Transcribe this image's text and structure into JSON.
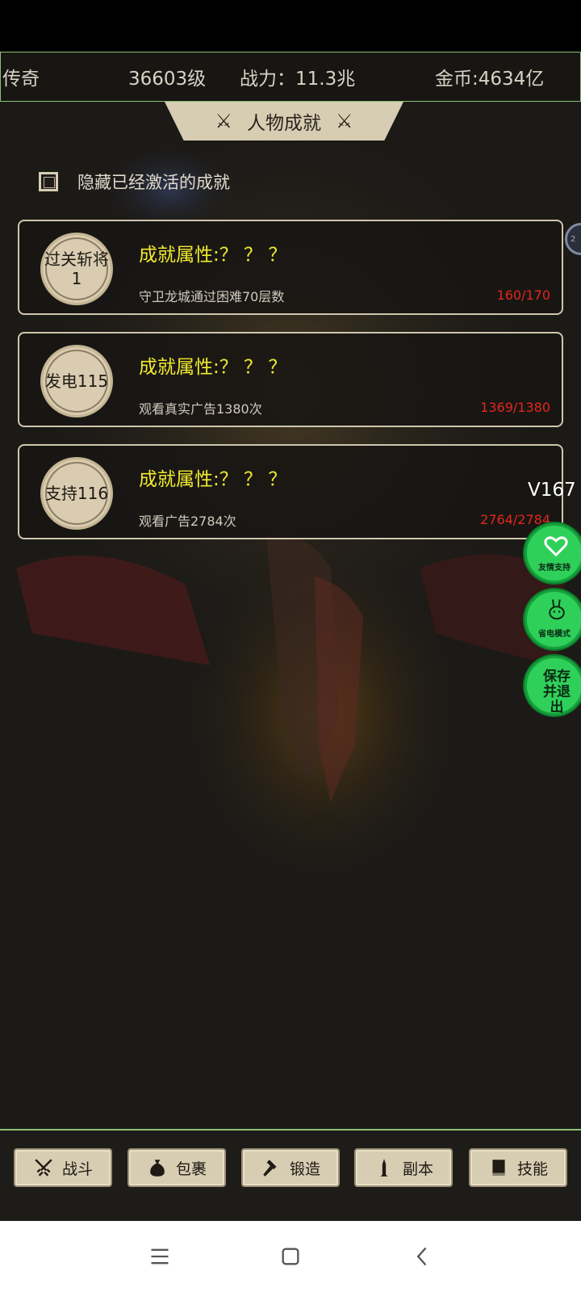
{
  "topbar": {
    "rank": "传奇",
    "level": "36603级",
    "power": "战力：11.3兆",
    "gold": "金币:4634亿"
  },
  "title": "人物成就",
  "hide_toggle": {
    "label": "隐藏已经激活的成就",
    "checked": false
  },
  "achievements": [
    {
      "badge": "过关斩将1",
      "attr": "成就属性:？ ？ ？",
      "desc": "守卫龙城通过困难70层数",
      "progress": "160/170"
    },
    {
      "badge": "发电115",
      "attr": "成就属性:？ ？ ？",
      "desc": "观看真实广告1380次",
      "progress": "1369/1380"
    },
    {
      "badge": "支持116",
      "attr": "成就属性:？ ？ ？",
      "desc": "观看广告2784次",
      "progress": "2764/2784"
    }
  ],
  "version": "V167",
  "side_buttons": {
    "friend_support": "友情支持",
    "power_save": "省电模式",
    "save_exit": "保存并退出"
  },
  "bottom_tabs": [
    {
      "label": "战斗",
      "icon": "crossed-swords-icon"
    },
    {
      "label": "包裹",
      "icon": "bag-icon"
    },
    {
      "label": "锻造",
      "icon": "hammer-icon"
    },
    {
      "label": "副本",
      "icon": "tower-icon"
    },
    {
      "label": "技能",
      "icon": "book-icon"
    }
  ],
  "colors": {
    "accent_yellow": "#f2ea2e",
    "progress_red": "#e3261c",
    "panel_beige": "#d6cdb3",
    "side_green": "#2fd05a"
  }
}
